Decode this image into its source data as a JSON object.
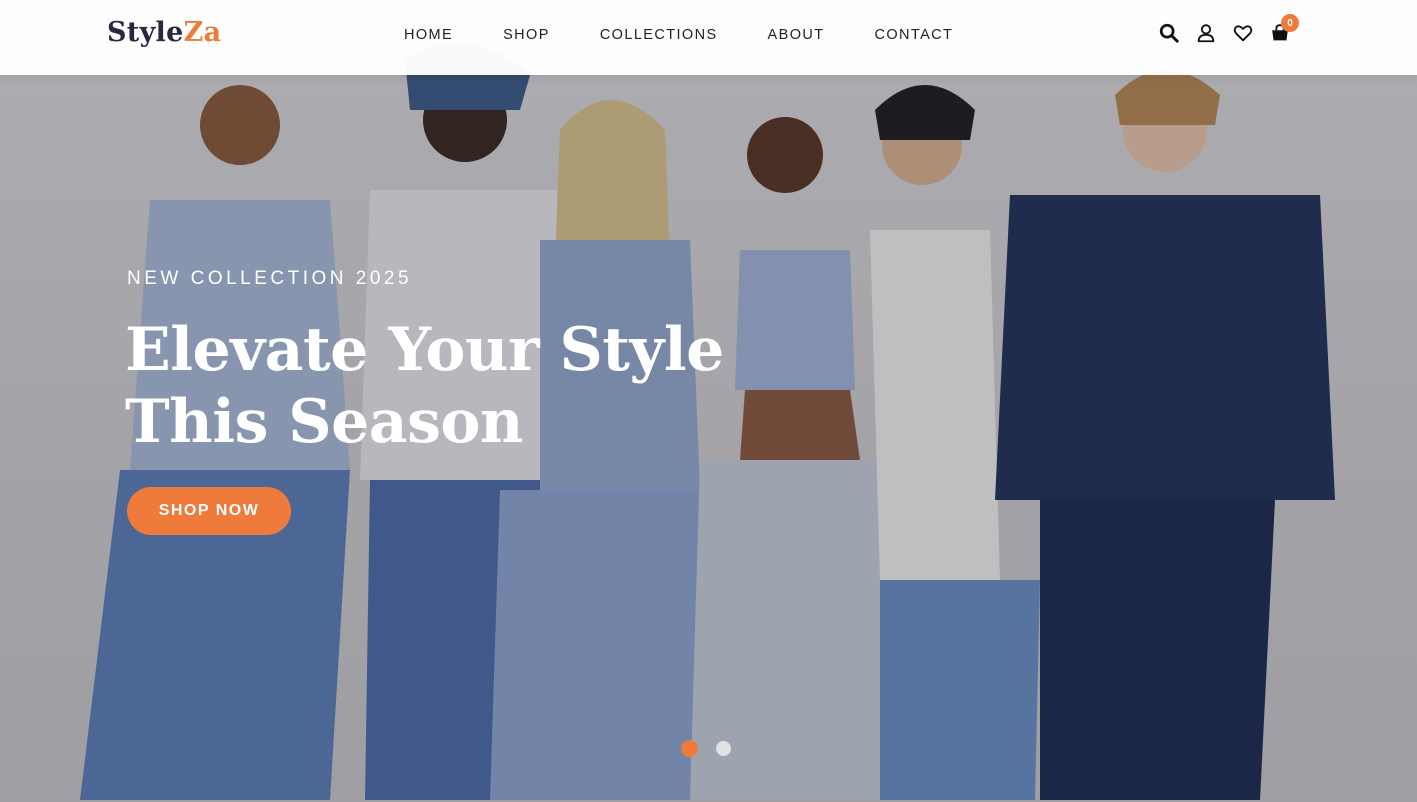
{
  "brand": {
    "logo_part1": "Style",
    "logo_part2": "Za",
    "accent_color": "#ee7a3c"
  },
  "nav": {
    "items": [
      {
        "label": "HOME"
      },
      {
        "label": "SHOP"
      },
      {
        "label": "COLLECTIONS"
      },
      {
        "label": "ABOUT"
      },
      {
        "label": "CONTACT"
      }
    ]
  },
  "header_icons": {
    "search": "search-icon",
    "account": "user-icon",
    "wishlist": "heart-icon",
    "cart": "shopping-bag-icon",
    "cart_count": "0"
  },
  "hero": {
    "eyebrow": "NEW COLLECTION 2025",
    "headline_line1": "Elevate Your Style",
    "headline_line2": "This Season",
    "cta_label": "SHOP NOW",
    "slides_total": 2,
    "active_slide": 1
  }
}
